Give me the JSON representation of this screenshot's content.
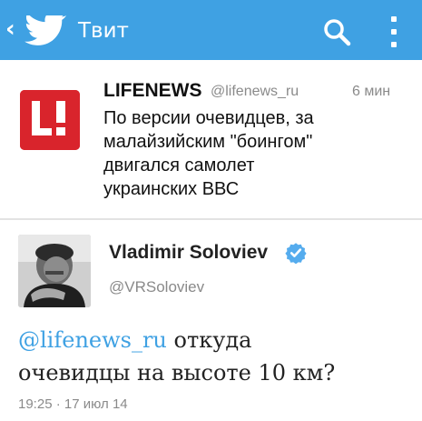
{
  "colors": {
    "accent": "#3fa1e3",
    "lifenews_red": "#d9242c",
    "verified_blue": "#55acee",
    "muted_text": "#8a8a8a"
  },
  "topbar": {
    "back_glyph": "‹",
    "logo_icon": "twitter-bird-icon",
    "title": "Твит",
    "search_icon": "search-icon",
    "menu_icon": "overflow-menu-icon"
  },
  "tweet_lifenews": {
    "avatar_icon": "lifenews-logo",
    "avatar_logo_text": "L!",
    "author_name": "LIFENEWS",
    "handle": "@lifenews_ru",
    "time": "6 мин",
    "text_lines": [
      "По версии очевидцев, за",
      "малайзийским \"боингом\"",
      "двигался самолет",
      "украинских ВВС"
    ]
  },
  "tweet_soloviev": {
    "avatar_icon": "user-photo-avatar",
    "author_name": "Vladimir Soloviev",
    "verified_icon": "verified-badge-icon",
    "handle": "@VRSoloviev",
    "mention": "@lifenews_ru",
    "text_line1_rest": " откуда",
    "text_line2": "очевидцы на высоте 10 км?",
    "timestamp": "19:25 · 17 июл 14"
  }
}
